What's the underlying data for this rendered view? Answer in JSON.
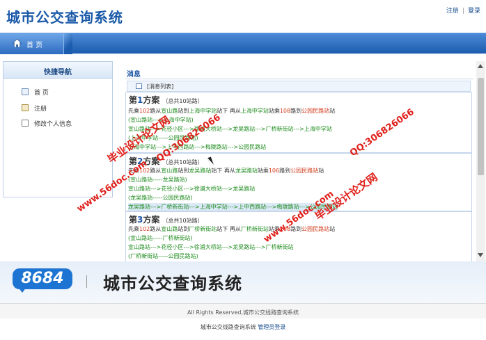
{
  "header": {
    "title": "城市公交查询系统",
    "register": "注册",
    "separator": "|",
    "login": "登录"
  },
  "nav": {
    "home": "首 页"
  },
  "sidebar": {
    "title": "快捷导航",
    "items": [
      {
        "label": "首 页"
      },
      {
        "label": "注册"
      },
      {
        "label": "修改个人信息"
      }
    ]
  },
  "main": {
    "section_title": "消息",
    "list_label": "[消息列表]",
    "plans": [
      {
        "prefix": "第",
        "num": "1",
        "suffix": "方案",
        "sub": "（总共10站路）",
        "lines": [
          [
            "先乘",
            "102",
            "路从",
            "宣山路",
            "站到",
            "上海中学站",
            "站下 再从",
            "上海中学站",
            "站乘",
            "108",
            "路到",
            "公园民路站",
            "站"
          ],
          [
            "(宣山路站--->上海中学站)"
          ],
          [
            "宣山路站--->花径小区--->徐浦大桥站--->龙吴路站--->厂桥新街站--->上海中学站"
          ],
          [
            "(上海中学站-----公园民路站)"
          ],
          [
            "上海中学站--->上中西路站--->梅陇路站--->公园民路站"
          ]
        ]
      },
      {
        "prefix": "第",
        "num": "2",
        "suffix": "方案",
        "sub": "（总共10站路）",
        "lines": [
          [
            "先乘",
            "102",
            "路从",
            "宣山路",
            "站到",
            "龙吴路站",
            "站下 再从",
            "龙吴路站",
            "站乘",
            "106",
            "路到",
            "公园民路站",
            "站"
          ],
          [
            "(宣山路站-----龙吴路站)"
          ],
          [
            "宣山路站--->花径小区--->徐浦大桥站--->龙吴路站"
          ],
          [
            "(龙吴路站-----公园民路站)"
          ],
          [
            "龙吴路站--->厂桥新街站--->上海中学站--->上中西路站--->梅陇路站--->公园民路站"
          ]
        ]
      },
      {
        "prefix": "第",
        "num": "3",
        "suffix": "方案",
        "sub": "（总共10站路）",
        "lines": [
          [
            "先乘",
            "102",
            "路从",
            "宣山路",
            "站到",
            "厂桥新街站",
            "站下 再从",
            "厂桥新街站",
            "站乘",
            "108",
            "路到",
            "公园民路站",
            "站"
          ],
          [
            "(宣山路站-----厂桥新街站)"
          ],
          [
            "宣山路站--->花径小区--->徐浦大桥站--->龙吴路站--->厂桥新街站"
          ],
          [
            "(厂桥新街站-----公园民路站)"
          ]
        ]
      }
    ]
  },
  "watermarks": [
    "毕业设计论文网",
    "www.56doc.com",
    "QQ:306826066",
    "毕业设计论文网",
    "www.56doc.com",
    "QQ:306826066"
  ],
  "banner": {
    "logo": "8684",
    "title": "城市公交查询系统"
  },
  "copyright": "All Rights Reserved,城市公交线路查询系统",
  "footer": {
    "text": "城市公交线路查询系统",
    "admin_login": "管理员登录"
  },
  "colors": {
    "brand_blue": "#1a5aa8",
    "route_green": "#1b8a1b",
    "station_red": "#d23a1a",
    "watermark_red": "#e0201a"
  },
  "icons": {
    "home": "home-icon"
  }
}
